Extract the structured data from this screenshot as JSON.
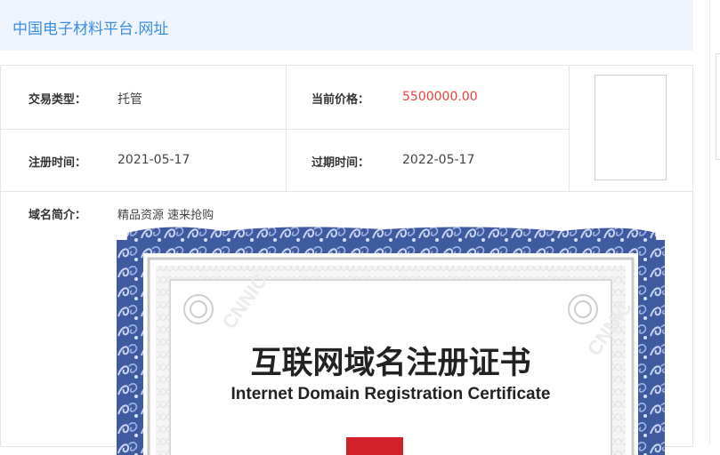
{
  "site": {
    "title": "中国电子材料平台.网址"
  },
  "details": {
    "trade_type_label": "交易类型：",
    "trade_type_value": "托管",
    "price_label": "当前价格：",
    "price_value": "5500000.00",
    "reg_date_label": "注册时间：",
    "reg_date_value": "2021-05-17",
    "exp_date_label": "过期时间：",
    "exp_date_value": "2022-05-17",
    "intro_label": "域名简介：",
    "intro_value": "精品资源 速来抢购"
  },
  "certificate": {
    "title_cn": "互联网域名注册证书",
    "title_en": "Internet Domain Registration Certificate",
    "watermark": "CNNIC"
  },
  "colors": {
    "accent": "#3a8ee6",
    "price": "#e8413a",
    "frame": "#3e5a9e"
  }
}
